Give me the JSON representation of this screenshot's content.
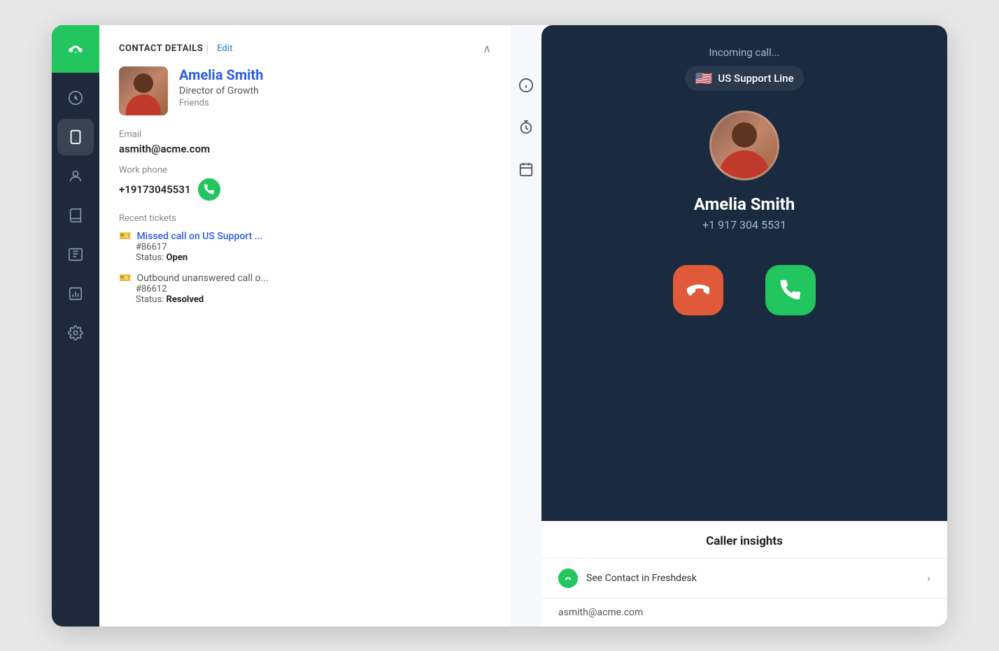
{
  "sidebar": {
    "logo_alt": "Freshdesk logo",
    "nav_items": [
      {
        "id": "dashboard",
        "label": "Dashboard",
        "active": false
      },
      {
        "id": "phone",
        "label": "Phone",
        "active": true
      },
      {
        "id": "contacts",
        "label": "Contacts",
        "active": false
      },
      {
        "id": "knowledge",
        "label": "Knowledge Base",
        "active": false
      },
      {
        "id": "tickets",
        "label": "Tickets",
        "active": false
      },
      {
        "id": "reports",
        "label": "Reports",
        "active": false
      },
      {
        "id": "settings",
        "label": "Settings",
        "active": false
      }
    ]
  },
  "contact_details": {
    "section_title": "CONTACT DETAILS",
    "edit_label": "Edit",
    "contact": {
      "name": "Amelia Smith",
      "role": "Director of Growth",
      "tag": "Friends",
      "email_label": "Email",
      "email": "asmith@acme.com",
      "work_phone_label": "Work phone",
      "work_phone": "+19173045531",
      "recent_tickets_label": "Recent tickets",
      "tickets": [
        {
          "title": "Missed call on US Support ...",
          "id": "#86617",
          "status": "Open"
        },
        {
          "title": "Outbound unanswered call o...",
          "id": "#86612",
          "status": "Resolved"
        }
      ]
    }
  },
  "right_icons": [
    {
      "id": "info",
      "label": "Info"
    },
    {
      "id": "timer",
      "label": "Timer"
    },
    {
      "id": "calendar",
      "label": "Calendar"
    }
  ],
  "incoming_call": {
    "incoming_label": "Incoming call...",
    "line_flag": "🇺🇸",
    "line_name": "US Support Line",
    "caller_name": "Amelia Smith",
    "caller_phone": "+1 917 304 5531",
    "decline_label": "Decline",
    "accept_label": "Accept"
  },
  "caller_insights": {
    "title": "Caller insights",
    "see_contact_label": "See Contact in Freshdesk",
    "chevron": "›",
    "email": "asmith@acme.com"
  }
}
